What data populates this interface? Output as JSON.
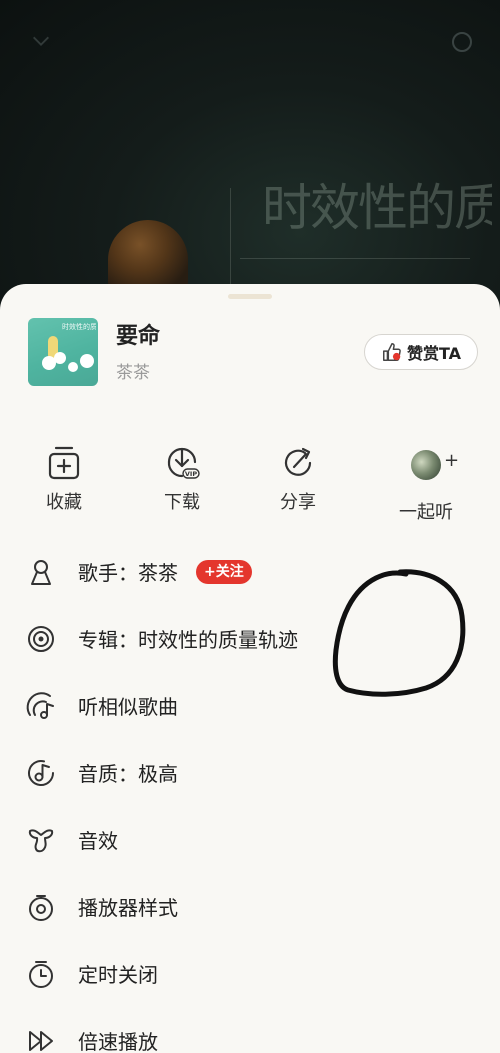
{
  "background": {
    "album_art_title": "时效性的质量轨迹"
  },
  "song": {
    "title": "要命",
    "artist": "茶茶",
    "tip_button_label": "赞赏TA"
  },
  "actions": [
    {
      "label": "收藏",
      "icon": "add-to-favorites-icon"
    },
    {
      "label": "下载",
      "icon": "download-vip-icon"
    },
    {
      "label": "分享",
      "icon": "share-icon"
    },
    {
      "label": "一起听",
      "icon": "avatar-plus",
      "plus": "+"
    }
  ],
  "menu": [
    {
      "label": "歌手：茶茶",
      "icon": "singer-icon",
      "badge": "+关注"
    },
    {
      "label": "专辑：时效性的质量轨迹",
      "icon": "album-disc-icon"
    },
    {
      "label": "听相似歌曲",
      "icon": "similar-songs-icon"
    },
    {
      "label": "音质：极高",
      "icon": "sound-quality-icon"
    },
    {
      "label": "音效",
      "icon": "sound-effect-icon"
    },
    {
      "label": "播放器样式",
      "icon": "player-style-icon"
    },
    {
      "label": "定时关闭",
      "icon": "timer-icon"
    },
    {
      "label": "倍速播放",
      "icon": "playback-speed-icon"
    }
  ],
  "colors": {
    "accent_red": "#e4362d",
    "sheet_bg": "#f9f8f4",
    "annotation": "#111111"
  }
}
